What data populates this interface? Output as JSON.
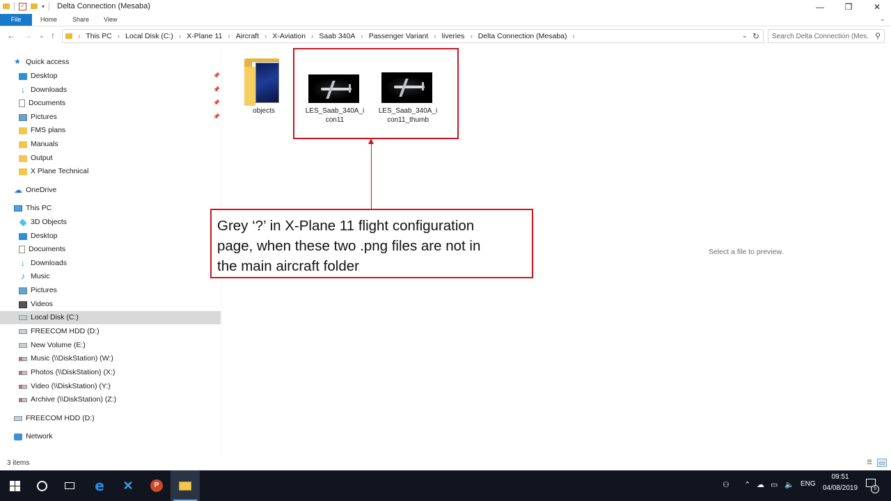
{
  "window": {
    "title": "Delta Connection (Mesaba)",
    "controls": {
      "minimize": "—",
      "restore": "❐",
      "close": "✕"
    }
  },
  "ribbon": {
    "tabs": [
      "File",
      "Home",
      "Share",
      "View"
    ],
    "expand": "⌄"
  },
  "nav_buttons": {
    "back": "←",
    "forward": "→",
    "recent": "⌄",
    "up": "↑"
  },
  "address": {
    "crumbs": [
      "This PC",
      "Local Disk (C:)",
      "X-Plane 11",
      "Aircraft",
      "X-Aviation",
      "Saab 340A",
      "Passenger Variant",
      "liveries",
      "Delta Connection (Mesaba)"
    ],
    "separator": "›",
    "dropdown": "⌄",
    "refresh": "↻"
  },
  "search": {
    "placeholder": "Search Delta Connection (Mes...",
    "icon": "search-icon"
  },
  "sidebar": {
    "quick_access": {
      "label": "Quick access",
      "items": [
        {
          "label": "Desktop",
          "icon": "desktop-icon",
          "pinned": true
        },
        {
          "label": "Downloads",
          "icon": "downloads-icon",
          "pinned": true
        },
        {
          "label": "Documents",
          "icon": "documents-icon",
          "pinned": true
        },
        {
          "label": "Pictures",
          "icon": "pictures-icon",
          "pinned": true
        },
        {
          "label": "FMS plans",
          "icon": "folder-icon",
          "pinned": false
        },
        {
          "label": "Manuals",
          "icon": "folder-icon",
          "pinned": false
        },
        {
          "label": "Output",
          "icon": "folder-icon",
          "pinned": false
        },
        {
          "label": "X Plane Technical",
          "icon": "folder-icon",
          "pinned": false
        }
      ]
    },
    "onedrive": "OneDrive",
    "this_pc": {
      "label": "This PC",
      "items": [
        {
          "label": "3D Objects",
          "icon": "3d-objects-icon"
        },
        {
          "label": "Desktop",
          "icon": "desktop-icon"
        },
        {
          "label": "Documents",
          "icon": "documents-icon"
        },
        {
          "label": "Downloads",
          "icon": "downloads-icon"
        },
        {
          "label": "Music",
          "icon": "music-icon"
        },
        {
          "label": "Pictures",
          "icon": "pictures-icon"
        },
        {
          "label": "Videos",
          "icon": "videos-icon"
        },
        {
          "label": "Local Disk (C:)",
          "icon": "local-disk-icon",
          "selected": true
        },
        {
          "label": "FREECOM HDD (D:)",
          "icon": "drive-icon"
        },
        {
          "label": "New Volume (E:)",
          "icon": "drive-icon"
        },
        {
          "label": "Music (\\\\DiskStation) (W:)",
          "icon": "network-drive-disconnected-icon"
        },
        {
          "label": "Photos (\\\\DiskStation) (X:)",
          "icon": "network-drive-disconnected-icon"
        },
        {
          "label": "Video (\\\\DiskStation) (Y:)",
          "icon": "network-drive-disconnected-icon"
        },
        {
          "label": "Archive (\\\\DiskStation) (Z:)",
          "icon": "network-drive-disconnected-icon"
        }
      ]
    },
    "freecom": "FREECOM HDD (D:)",
    "network": "Network"
  },
  "content": {
    "files": [
      {
        "name": "objects",
        "type": "folder"
      },
      {
        "name": "LES_Saab_340A_icon11",
        "type": "png"
      },
      {
        "name": "LES_Saab_340A_icon11_thumb",
        "type": "png"
      }
    ],
    "file_label_lines": [
      [
        "objects"
      ],
      [
        "LES_Saab_340A_i",
        "con11"
      ],
      [
        "LES_Saab_340A_i",
        "con11_thumb"
      ]
    ],
    "callout_lines": [
      "Grey ‘?’ in X-Plane 11 flight configuration",
      "page, when these two .png files are not in",
      "the main aircraft folder"
    ],
    "annotation_color": "#d0121f"
  },
  "preview": {
    "text": "Select a file to preview."
  },
  "status": {
    "count": "3 items"
  },
  "taskbar": {
    "apps": [
      "start-icon",
      "cortana-search-icon",
      "task-view-icon",
      "edge-icon",
      "xplane-icon",
      "powerpoint-icon",
      "file-explorer-icon"
    ],
    "ppt_letter": "P",
    "xplane_letter": "✕",
    "edge_letter": "e",
    "tray_language": "ENG",
    "time": "09:51",
    "date": "04/08/2019",
    "notification_count": "5"
  }
}
